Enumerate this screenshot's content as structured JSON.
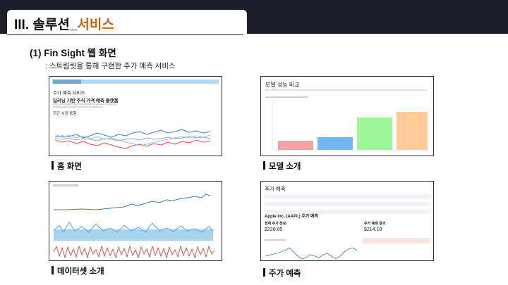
{
  "slide": {
    "title_prefix": "III. 솔루션_",
    "title_accent": "서비스",
    "subtitle": "(1) Fin Sight 웹 화면",
    "description": ": 스트림릿을 통해 구현한 주가 예측 서비스",
    "accent_color": "#c5621c",
    "topbar_color": "#1c1f2b"
  },
  "screens": {
    "home": {
      "caption": "홈 화면",
      "page_title": "주가 예측 서비스",
      "headline": "딥러닝 기반 주식 가격 예측 플랫폼",
      "section": "최근 시장 동향"
    },
    "models": {
      "caption": "모델 소개",
      "page_title": "모델 성능 비교",
      "bar_colors": [
        "#f4a3a3",
        "#74b6f0",
        "#9ef59a",
        "#ffcc99"
      ]
    },
    "dataset": {
      "caption": "데이터셋 소개"
    },
    "predict": {
      "caption": "주가 예측",
      "page_title": "주가 예측",
      "company_heading": "Apple Inc. (AAPL) 주가 예측",
      "current_label": "현재 주가 정보",
      "current_price": "$226.05",
      "result_label": "주가 예측 결과",
      "predicted_price": "$214.18"
    }
  }
}
